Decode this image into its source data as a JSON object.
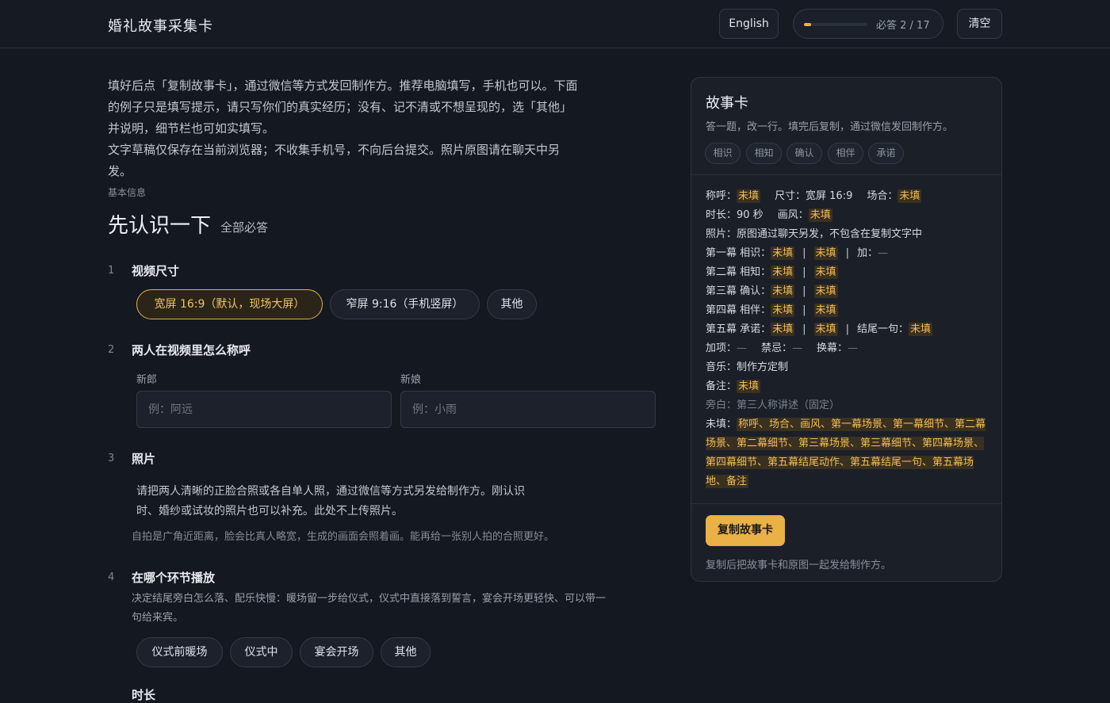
{
  "header": {
    "title": "婚礼故事采集卡",
    "lang_button": "English",
    "progress_text": "必答 2 / 17",
    "progress_fraction": 0.118,
    "clear_button": "清空"
  },
  "intro": {
    "para1": "填好后点「复制故事卡」，通过微信等方式发回制作方。推荐电脑填写，手机也可以。下面的例子只是填写提示，请只写你们的真实经历；没有、记不清或不想呈现的，选「其他」并说明，细节栏也可如实填写。",
    "para2": "文字草稿仅保存在当前浏览器；不收集手机号，不向后台提交。照片原图请在聊天中另发。"
  },
  "section": {
    "eyebrow": "基本信息",
    "title": "先认识一下",
    "subtitle": "全部必答"
  },
  "questions": {
    "q1": {
      "num": "1",
      "title": "视频尺寸",
      "options": [
        "宽屏 16:9（默认，现场大屏）",
        "窄屏 9:16（手机竖屏）",
        "其他"
      ]
    },
    "q2": {
      "num": "2",
      "title": "两人在视频里怎么称呼",
      "groom_label": "新郎",
      "groom_placeholder": "例：阿远",
      "bride_label": "新娘",
      "bride_placeholder": "例：小雨"
    },
    "q3": {
      "num": "3",
      "title": "照片",
      "text_line1": "请把两人清晰的正脸合照或各自单人照，通过微信等方式另发给制作方。刚认识",
      "text_line2": "时、婚纱或试妆的照片也可以补充。此处不上传照片。",
      "hint": "自拍是广角近距离，脸会比真人略宽，生成的画面会照着画。能再给一张别人拍的合照更好。"
    },
    "q4": {
      "num": "4",
      "title": "在哪个环节播放",
      "desc_line1": "决定结尾旁白怎么落、配乐快慢：暖场留一步给仪式，仪式中直接落到誓言，宴会开场更轻快、可以带一",
      "desc_line2": "句给来宾。",
      "options": [
        "仪式前暖场",
        "仪式中",
        "宴会开场",
        "其他"
      ]
    },
    "q5": {
      "title": "时长"
    }
  },
  "card": {
    "title": "故事卡",
    "subtitle": "答一题，改一行。填完后复制，通过微信发回制作方。",
    "tags": [
      "相识",
      "相知",
      "确认",
      "相伴",
      "承诺"
    ],
    "pending": "未填",
    "dash": "—",
    "sep": "|",
    "lines": {
      "name_k": "称呼：",
      "size_k": "尺寸：宽屏 16:9",
      "occasion_k": "场合：",
      "duration_k": "时长：90 秒",
      "style_k": "画风：",
      "photo": "照片：原图通过聊天另发，不包含在复制文字中",
      "act1_k": "第一幕 相识：",
      "act2_k": "第二幕 相知：",
      "act3_k": "第三幕 确认：",
      "act4_k": "第四幕 相伴：",
      "act5_k": "第五幕 承诺：",
      "extra_k": "加：",
      "closing_k": "结尾一句：",
      "addons_k": "加项：",
      "taboo_k": "禁忌：",
      "switch_k": "换幕：",
      "music": "音乐：制作方定制",
      "notes_k": "备注：",
      "narration": "旁白：第三人称讲述（固定）",
      "unfilled_k": "未填：",
      "unfilled_list": "称呼、场合、画风、第一幕场景、第一幕细节、第二幕场景、第二幕细节、第三幕场景、第三幕细节、第四幕场景、第四幕细节、第五幕结尾动作、第五幕结尾一句、第五幕场地、备注"
    },
    "copy_button": "复制故事卡",
    "foot_note": "复制后把故事卡和原图一起发给制作方。"
  },
  "colors": {
    "accent": "#e9b146",
    "background": "#141821",
    "card": "#1b1f28"
  }
}
